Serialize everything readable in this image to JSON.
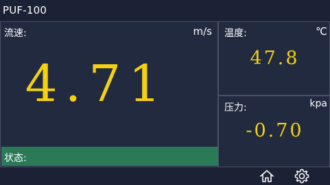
{
  "app": {
    "title": "PUF-100"
  },
  "flow": {
    "label": "流速:",
    "unit": "m/s",
    "value": "4.71"
  },
  "temperature": {
    "label": "温度:",
    "unit": "℃",
    "value": "47.8"
  },
  "pressure": {
    "label": "压力:",
    "unit": "kpa",
    "value": "-0.70"
  },
  "status": {
    "label": "状态:"
  },
  "toolbar": {
    "home_icon": "home-icon",
    "settings_icon": "gear-icon"
  },
  "colors": {
    "background": "#1c2236",
    "panel": "#222a40",
    "value": "#f5d10f",
    "status_bar": "#2a7a58"
  }
}
